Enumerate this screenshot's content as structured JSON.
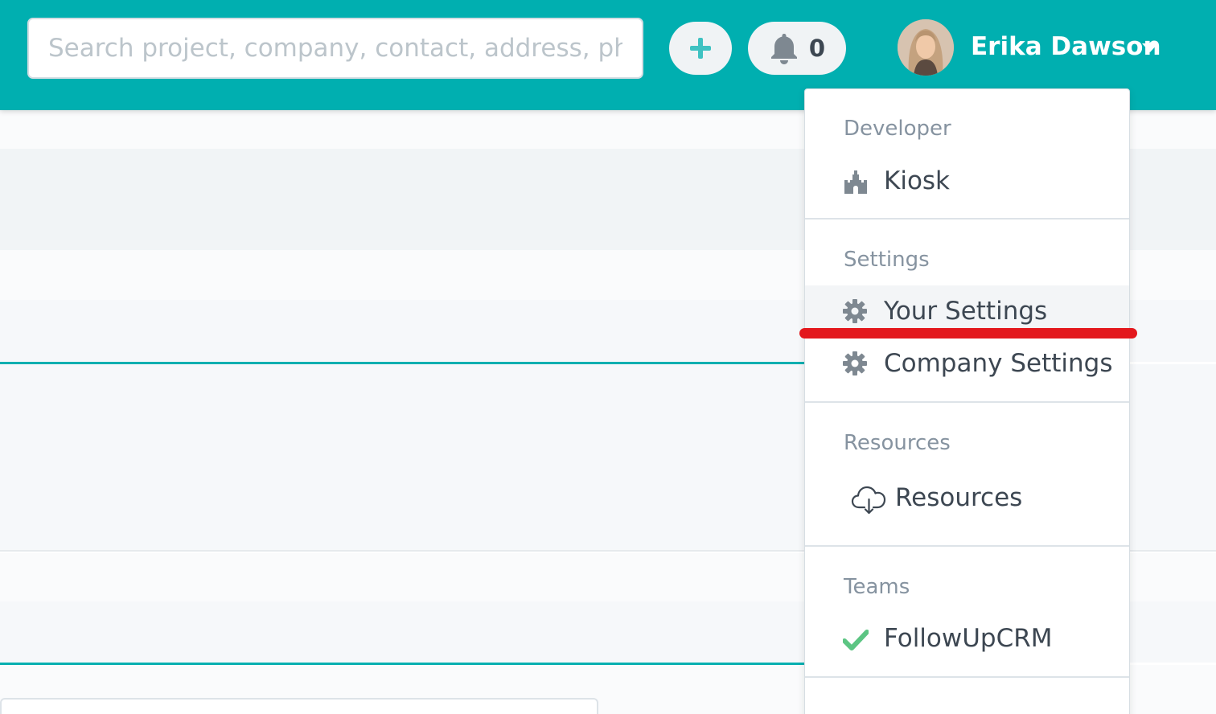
{
  "header": {
    "search_placeholder": "Search project, company, contact, address, phone",
    "add_icon": "plus-icon",
    "notifications_icon": "bell-icon",
    "notification_count": "0",
    "user_name": "Erika Dawson"
  },
  "colors": {
    "brand": "#00afb0",
    "annotation": "#e3181d",
    "check": "#5cc583",
    "icon_gray": "#7e8891"
  },
  "menu": {
    "developer": {
      "header": "Developer",
      "items": [
        {
          "label": "Kiosk",
          "icon": "castle-icon"
        }
      ]
    },
    "settings": {
      "header": "Settings",
      "items": [
        {
          "label": "Your Settings",
          "icon": "gear-icon"
        },
        {
          "label": "Company Settings",
          "icon": "gear-icon"
        }
      ]
    },
    "resources": {
      "header": "Resources",
      "items": [
        {
          "label": "Resources",
          "icon": "cloud-download-icon"
        }
      ]
    },
    "teams": {
      "header": "Teams",
      "items": [
        {
          "label": "FollowUpCRM",
          "icon": "check-icon"
        }
      ]
    }
  }
}
